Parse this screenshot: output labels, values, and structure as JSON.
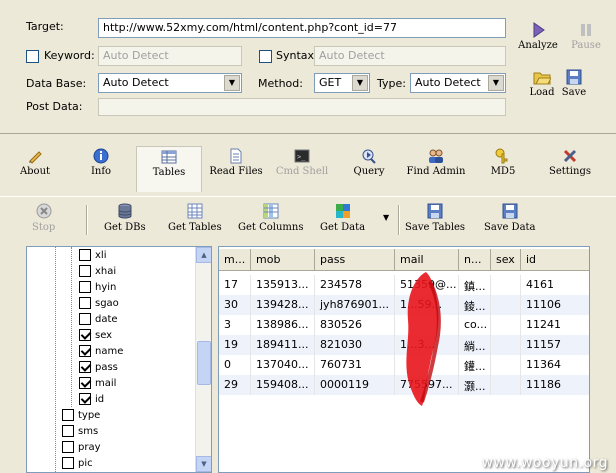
{
  "form": {
    "target_label": "Target:",
    "target_value": "http://www.52xmy.com/html/content.php?cont_id=77",
    "keyword_label": "Keyword:",
    "keyword_placeholder": "Auto Detect",
    "syntax_label": "Syntax:",
    "syntax_placeholder": "Auto Detect",
    "database_label": "Data Base:",
    "database_value": "Auto Detect",
    "method_label": "Method:",
    "method_value": "GET",
    "type_label": "Type:",
    "type_value": "Auto Detect",
    "postdata_label": "Post Data:",
    "postdata_value": ""
  },
  "actions": {
    "analyze": "Analyze",
    "pause": "Pause",
    "load": "Load",
    "save": "Save"
  },
  "tabs": [
    {
      "label": "About",
      "icon": "about-icon"
    },
    {
      "label": "Info",
      "icon": "info-icon"
    },
    {
      "label": "Tables",
      "icon": "tables-icon"
    },
    {
      "label": "Read Files",
      "icon": "read-files-icon"
    },
    {
      "label": "Cmd Shell",
      "icon": "cmd-shell-icon"
    },
    {
      "label": "Query",
      "icon": "query-icon"
    },
    {
      "label": "Find Admin",
      "icon": "find-admin-icon"
    },
    {
      "label": "MD5",
      "icon": "md5-icon"
    },
    {
      "label": "Settings",
      "icon": "settings-icon"
    }
  ],
  "toolbar": {
    "stop": "Stop",
    "get_dbs": "Get DBs",
    "get_tables": "Get Tables",
    "get_columns": "Get Columns",
    "get_data": "Get Data",
    "save_tables": "Save Tables",
    "save_data": "Save Data"
  },
  "tree": {
    "columns": [
      {
        "label": "xli",
        "checked": false
      },
      {
        "label": "xhai",
        "checked": false
      },
      {
        "label": "hyin",
        "checked": false
      },
      {
        "label": "sgao",
        "checked": false
      },
      {
        "label": "date",
        "checked": false
      },
      {
        "label": "sex",
        "checked": true
      },
      {
        "label": "name",
        "checked": true
      },
      {
        "label": "pass",
        "checked": true
      },
      {
        "label": "mail",
        "checked": true
      },
      {
        "label": "id",
        "checked": true
      }
    ],
    "tables": [
      {
        "label": "type",
        "checked": false
      },
      {
        "label": "sms",
        "checked": false
      },
      {
        "label": "pray",
        "checked": false
      },
      {
        "label": "pic",
        "checked": false
      }
    ]
  },
  "grid": {
    "headers": [
      "m...",
      "mob",
      "pass",
      "mail",
      "n...",
      "sex",
      "id"
    ],
    "rows": [
      [
        "17",
        "135913...",
        "234578",
        "51359@...",
        "鎮...",
        "",
        "4161"
      ],
      [
        "30",
        "139428...",
        "jyh876901...",
        "1...59...",
        "錂...",
        "",
        "11106"
      ],
      [
        "3",
        "138986...",
        "830526",
        "",
        "co...",
        "",
        "11241"
      ],
      [
        "19",
        "189411...",
        "821030",
        "1...3...",
        "緔...",
        "",
        "11157"
      ],
      [
        "0",
        "137040...",
        "760731",
        "",
        "鑵...",
        "",
        "11364"
      ],
      [
        "29",
        "159408...",
        "0000119",
        "775597...",
        "灏...",
        "",
        "11186"
      ]
    ]
  },
  "watermark": "www.wooyun.org",
  "colors": {
    "panel_bg": "#ece9d8",
    "field_border": "#7f9db9",
    "row_alt": "#eef2fb",
    "redaction": "#e8141b"
  }
}
